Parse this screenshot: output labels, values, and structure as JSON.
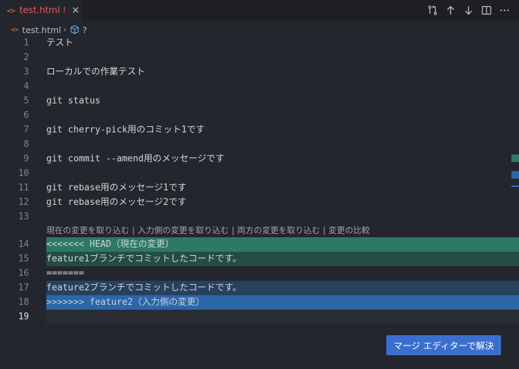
{
  "tab": {
    "icon": "<>",
    "label": "test.html",
    "modified_mark": "!",
    "close": "×"
  },
  "toolbar": {
    "icons": [
      "compare-changes-icon",
      "arrow-up-icon",
      "arrow-down-icon",
      "split-editor-icon",
      "more-actions-icon"
    ]
  },
  "breadcrumb": {
    "icon": "<>",
    "file": "test.html",
    "sep": "›",
    "symbol": "?"
  },
  "editor": {
    "lines": [
      {
        "num": "1",
        "text": "テスト"
      },
      {
        "num": "2",
        "text": ""
      },
      {
        "num": "3",
        "text": "ローカルでの作業テスト"
      },
      {
        "num": "4",
        "text": ""
      },
      {
        "num": "5",
        "text": "git status"
      },
      {
        "num": "6",
        "text": ""
      },
      {
        "num": "7",
        "text": "git cherry-pick用のコミット1です"
      },
      {
        "num": "8",
        "text": ""
      },
      {
        "num": "9",
        "text": "git commit --amend用のメッセージです"
      },
      {
        "num": "10",
        "text": ""
      },
      {
        "num": "11",
        "text": "git rebase用のメッセージ1です"
      },
      {
        "num": "12",
        "text": "git rebase用のメッセージ2です"
      },
      {
        "num": "13",
        "text": ""
      },
      {
        "num": "14",
        "text": "<<<<<<< HEAD（現在の変更）"
      },
      {
        "num": "15",
        "text": "feature1ブランチでコミットしたコードです。"
      },
      {
        "num": "16",
        "text": "======="
      },
      {
        "num": "17",
        "text": "feature2ブランチでコミットしたコードです。"
      },
      {
        "num": "18",
        "text": ">>>>>>> feature2（入力側の変更）"
      },
      {
        "num": "19",
        "text": ""
      }
    ],
    "codelens": {
      "accept_current": "現在の変更を取り込む",
      "accept_incoming": "入力側の変更を取り込む",
      "accept_both": "両方の変更を取り込む",
      "compare": "変更の比較",
      "separator": "|"
    }
  },
  "merge_button": {
    "label": "マージ エディターで解決"
  },
  "colors": {
    "current_header": "#2e7866",
    "current_body": "#244c45",
    "incoming_body": "#27405e",
    "incoming_header": "#2b66a8",
    "button": "#3b6fcf",
    "tab_label": "#e35a5a"
  }
}
